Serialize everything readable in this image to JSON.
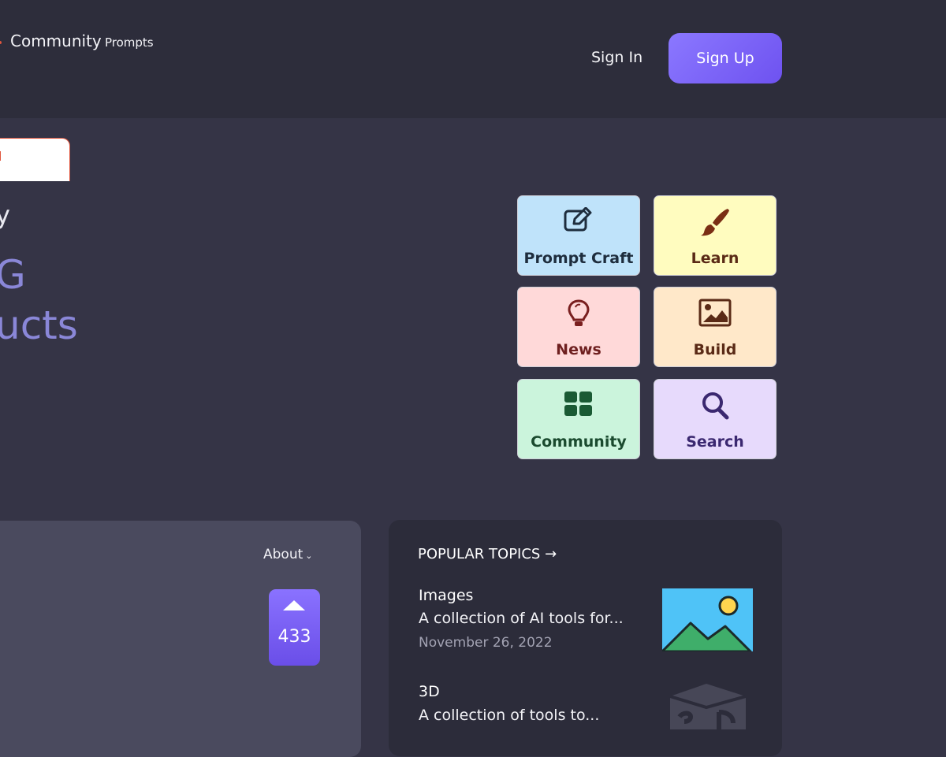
{
  "header": {
    "brand": "Community",
    "brand_sub": "Prompts",
    "signin_label": "Sign In",
    "signup_label": "Sign Up"
  },
  "hero": {
    "line1": "y",
    "line2": "G",
    "line3": "ucts"
  },
  "tiles": [
    {
      "label": "Prompt Craft",
      "icon": "edit-icon"
    },
    {
      "label": "Learn",
      "icon": "paintbrush-icon"
    },
    {
      "label": "News",
      "icon": "lightbulb-icon"
    },
    {
      "label": "Build",
      "icon": "image-icon"
    },
    {
      "label": "Community",
      "icon": "grid-icon"
    },
    {
      "label": "Search",
      "icon": "search-icon"
    }
  ],
  "left_panel": {
    "about_label": "About",
    "vote_count": "433"
  },
  "popular": {
    "heading": "POPULAR TOPICS →",
    "topics": [
      {
        "title": "Images",
        "desc": "A collection of AI tools for...",
        "date": "November 26, 2022"
      },
      {
        "title": "3D",
        "desc": "A collection of tools to..."
      }
    ]
  },
  "colors": {
    "background": "#353446",
    "header": "#2d2d3b",
    "accent": "#7b63f7",
    "hero_text": "#8a87d8"
  }
}
